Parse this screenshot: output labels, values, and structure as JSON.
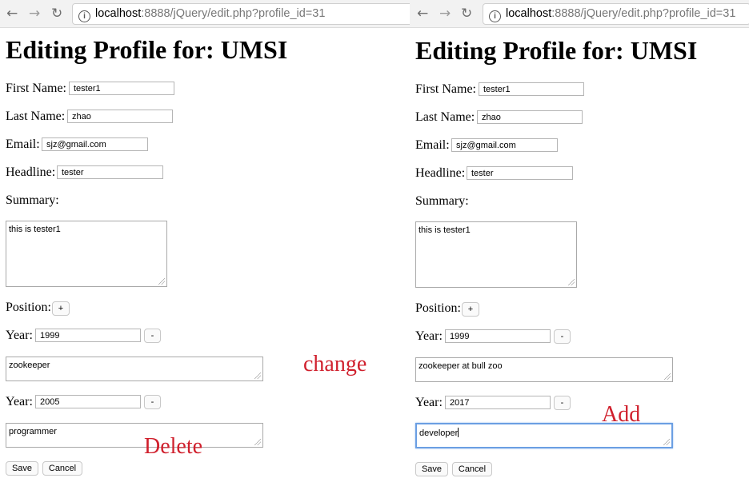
{
  "browser": {
    "url_host": "localhost",
    "url_rest": ":8888/jQuery/edit.php?profile_id=31"
  },
  "page": {
    "title": "Editing Profile for: UMSI",
    "first_name_label": "First Name:",
    "last_name_label": "Last Name:",
    "email_label": "Email:",
    "headline_label": "Headline:",
    "summary_label": "Summary:",
    "position_label": "Position:",
    "year_label": "Year:",
    "add_position_button": "+",
    "remove_position_button": "-",
    "save_button": "Save",
    "cancel_button": "Cancel"
  },
  "before": {
    "first_name": "tester1",
    "last_name": "zhao",
    "email": "sjz@gmail.com",
    "headline": "tester",
    "summary": "this is tester1",
    "positions": [
      {
        "year": "1999",
        "description": "zookeeper"
      },
      {
        "year": "2005",
        "description": "programmer"
      }
    ]
  },
  "after": {
    "first_name": "tester1",
    "last_name": "zhao",
    "email": "sjz@gmail.com",
    "headline": "tester",
    "summary": "this is tester1",
    "positions": [
      {
        "year": "1999",
        "description": "zookeeper at bull zoo"
      },
      {
        "year": "2017",
        "description": "developer"
      }
    ]
  },
  "annotations": {
    "change": "change",
    "delete": "Delete",
    "add": "Add",
    "color": "#d0202d"
  }
}
